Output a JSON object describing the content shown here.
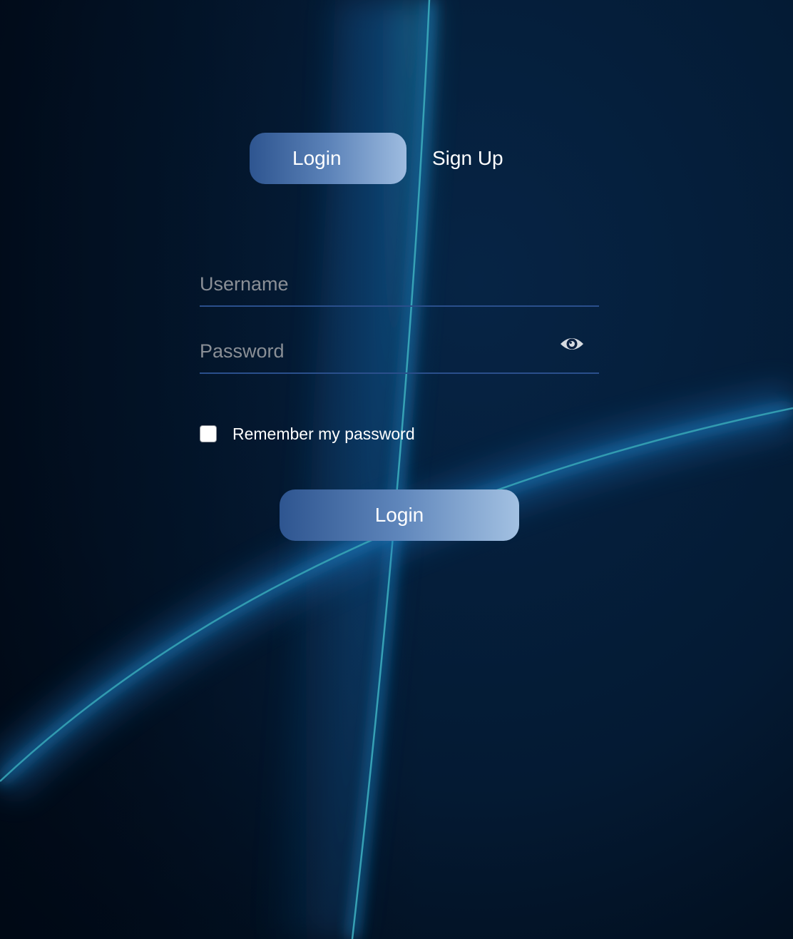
{
  "tabs": {
    "login_label": "Login",
    "signup_label": "Sign Up"
  },
  "form": {
    "username_placeholder": "Username",
    "username_value": "",
    "password_placeholder": "Password",
    "password_value": "",
    "password_toggle_icon": "eye-icon",
    "remember_label": "Remember my password",
    "remember_checked": false,
    "submit_label": "Login"
  },
  "colors": {
    "background": "#03132a",
    "accent_start": "#2e5590",
    "accent_end": "#9ebce0",
    "field_underline": "#2a4f8c",
    "curve_glow": "#1e7ac4"
  }
}
